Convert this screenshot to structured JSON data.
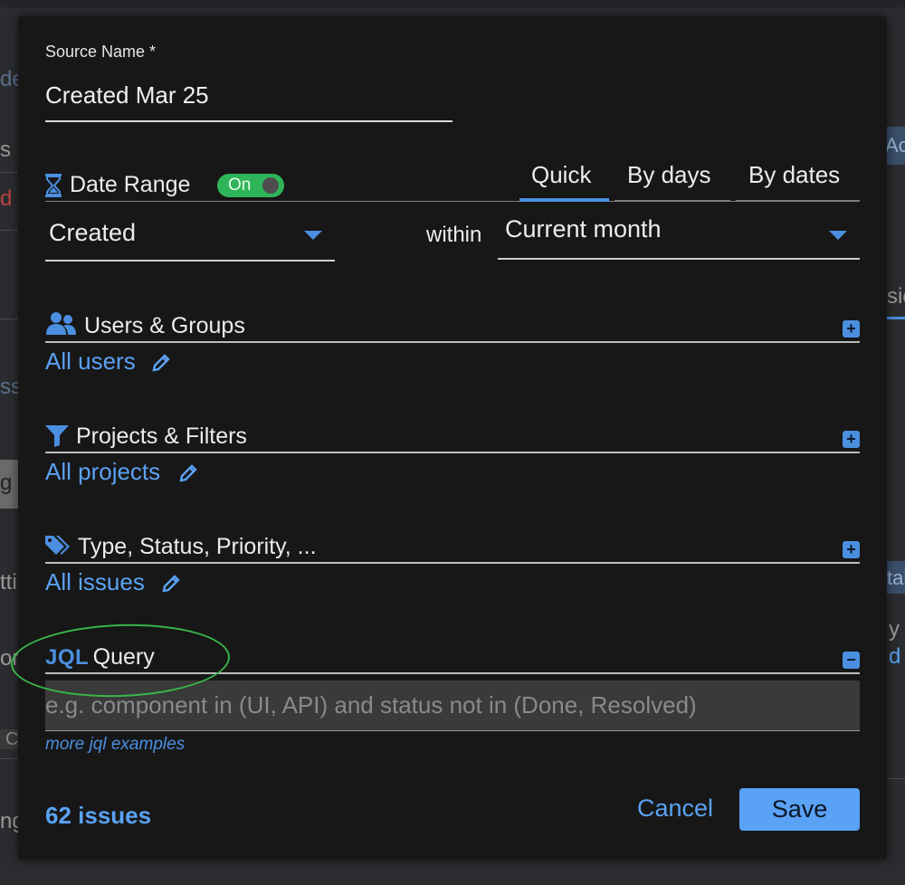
{
  "dialog": {
    "source_name": {
      "label": "Source Name *",
      "value": "Created Mar 25"
    },
    "date_range": {
      "label": "Date Range",
      "toggle": "On",
      "tabs": [
        "Quick",
        "By days",
        "By dates"
      ],
      "active_tab": "Quick",
      "field": "Created",
      "within_label": "within",
      "period": "Current month"
    },
    "users_groups": {
      "title": "Users & Groups",
      "link": "All users",
      "action": "+"
    },
    "projects_filters": {
      "title": "Projects & Filters",
      "link": "All projects",
      "action": "+"
    },
    "type_status": {
      "title": "Type, Status, Priority, ...",
      "link": "All issues",
      "action": "+"
    },
    "jql": {
      "title_prefix": "JQL",
      "title_rest": "Query",
      "action": "−",
      "placeholder": "e.g. component in (UI, API) and status not in (Done, Resolved)",
      "more_link": "more jql examples"
    },
    "footer": {
      "issues_count": "62 issues",
      "cancel": "Cancel",
      "save": "Save"
    }
  },
  "background": {
    "fragments": [
      "de",
      "s",
      "d a",
      "Ac",
      "ssi",
      "sic",
      "g",
      "tti",
      "tal",
      "or",
      "y",
      "d",
      "C",
      "ng"
    ]
  },
  "colors": {
    "accent": "#4a8fe0",
    "link": "#5aa2f5",
    "toggle_on": "#2fb45a",
    "annotation": "#39b54a",
    "dialog_bg": "#171717"
  }
}
